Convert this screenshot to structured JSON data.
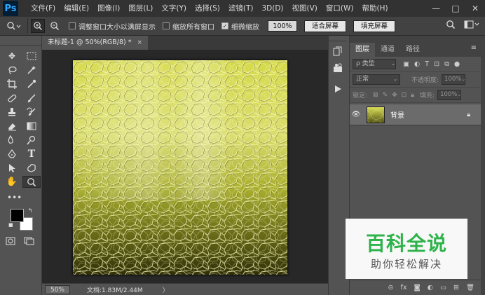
{
  "app": {
    "logo": "Ps"
  },
  "menu": [
    "文件(F)",
    "编辑(E)",
    "图像(I)",
    "图层(L)",
    "文字(Y)",
    "选择(S)",
    "滤镜(T)",
    "3D(D)",
    "视图(V)",
    "窗口(W)",
    "帮助(H)"
  ],
  "window_controls": {
    "minimize": "—",
    "restore": "□",
    "close": "✕"
  },
  "options": {
    "resize_window_label": "调整窗口大小以满屏显示",
    "resize_window_checked": false,
    "zoom_all_label": "缩放所有窗口",
    "zoom_all_checked": false,
    "scrubby_zoom_label": "细微缩放",
    "scrubby_zoom_checked": true,
    "zoom_percent": "100%",
    "fit_screen": "适合屏幕",
    "fill_screen": "填充屏幕"
  },
  "document": {
    "tab_title": "未标题-1 @ 50%(RGB/8) *",
    "close": "×",
    "status_zoom": "50%",
    "status_info": "文档:1.83M/2.44M",
    "status_arrow": "〉"
  },
  "layers_panel": {
    "tabs": [
      "图层",
      "通道",
      "路径"
    ],
    "kind_filter": "ρ 类型",
    "blend_mode": "正常",
    "opacity_label": "不透明度:",
    "opacity_value": "100%",
    "lock_label": "锁定:",
    "fill_label": "填充:",
    "fill_value": "100%",
    "layers": [
      {
        "name": "背景",
        "visible": true,
        "locked": true
      }
    ]
  },
  "watermark": {
    "main": "百科全说",
    "sub": "助你轻松解决"
  },
  "colors": {
    "foreground": "#000000",
    "background": "#ffffff",
    "canvas_tint": "#c8cc3a",
    "watermark_green": "#2db34a"
  }
}
